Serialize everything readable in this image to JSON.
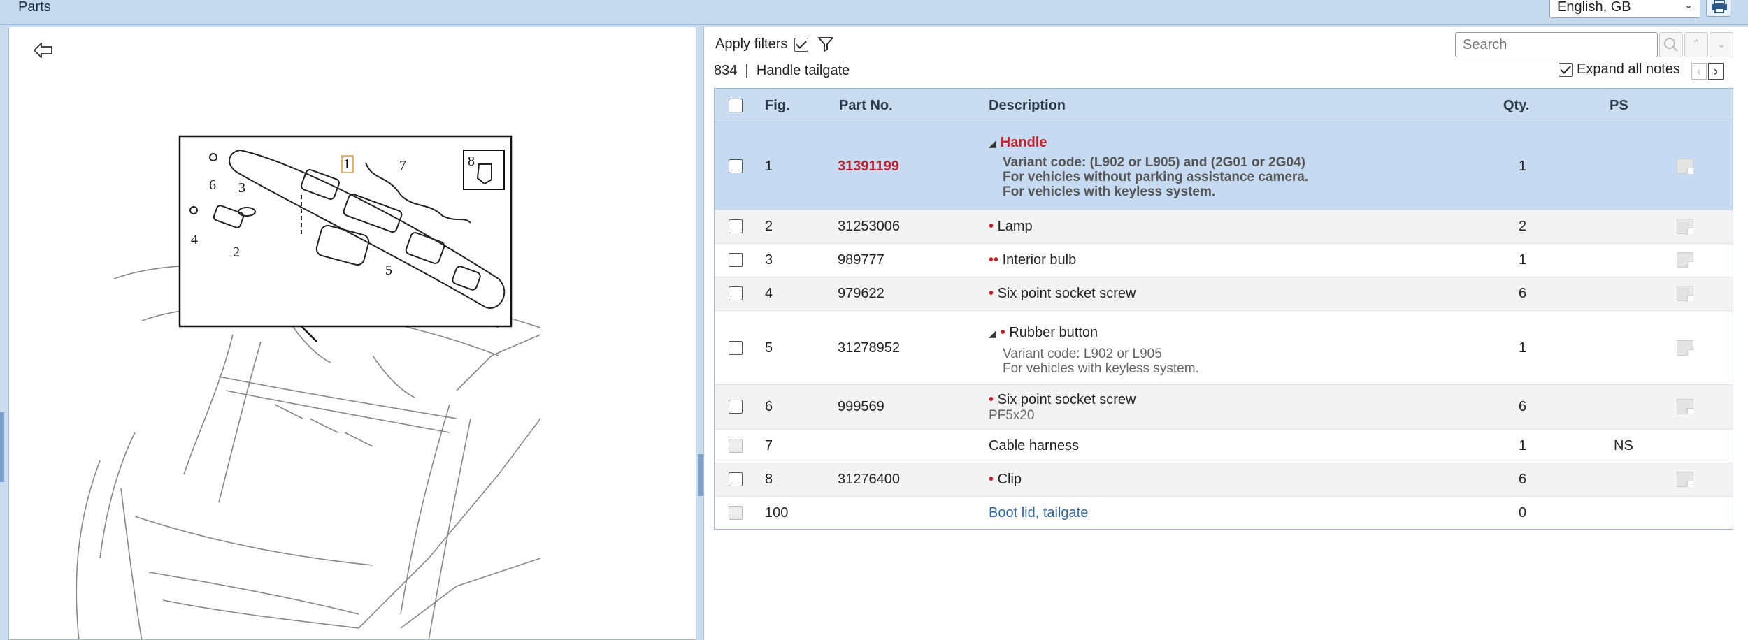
{
  "window": {
    "title": "Parts"
  },
  "language": {
    "selected": "English, GB"
  },
  "filters": {
    "label": "Apply filters",
    "checked": true
  },
  "search": {
    "placeholder": "Search"
  },
  "breadcrumb": {
    "code": "834",
    "separator": "|",
    "name": "Handle tailgate"
  },
  "expand_notes": {
    "label": "Expand all notes",
    "checked": true
  },
  "diagram": {
    "callouts": [
      "1",
      "2",
      "3",
      "4",
      "5",
      "6",
      "7",
      "8"
    ]
  },
  "table": {
    "headers": {
      "fig": "Fig.",
      "part": "Part No.",
      "desc": "Description",
      "qty": "Qty.",
      "ps": "PS"
    },
    "rows": [
      {
        "fig": "1",
        "part": "31391199",
        "prefix": "◢",
        "desc": "Handle",
        "qty": "1",
        "ps": "",
        "notes": [
          "Variant code: (L902 or L905) and (2G01 or 2G04)",
          "For vehicles without parking assistance camera.",
          "For vehicles with keyless system."
        ]
      },
      {
        "fig": "2",
        "part": "31253006",
        "prefix": "•",
        "desc": "Lamp",
        "qty": "2",
        "ps": ""
      },
      {
        "fig": "3",
        "part": "989777",
        "prefix": "••",
        "desc": "Interior bulb",
        "qty": "1",
        "ps": ""
      },
      {
        "fig": "4",
        "part": "979622",
        "prefix": "•",
        "desc": "Six point socket screw",
        "qty": "6",
        "ps": ""
      },
      {
        "fig": "5",
        "part": "31278952",
        "prefix": "•",
        "desc": "Rubber button",
        "qty": "1",
        "ps": "",
        "notes": [
          "Variant code: L902 or L905",
          "For vehicles with keyless system."
        ]
      },
      {
        "fig": "6",
        "part": "999569",
        "prefix": "•",
        "desc": "Six point socket screw",
        "qty": "6",
        "ps": "",
        "sub": "PF5x20"
      },
      {
        "fig": "7",
        "part": "",
        "prefix": "",
        "desc": "Cable harness",
        "qty": "1",
        "ps": "NS"
      },
      {
        "fig": "8",
        "part": "31276400",
        "prefix": "•",
        "desc": "Clip",
        "qty": "6",
        "ps": ""
      },
      {
        "fig": "100",
        "part": "",
        "prefix": "",
        "desc": "Boot lid, tailgate",
        "qty": "0",
        "ps": ""
      }
    ]
  },
  "colors": {
    "accent": "#c9dcf0",
    "selected_row": "#c6dbf1",
    "part_red": "#c0232e",
    "link": "#2f6aa6"
  }
}
